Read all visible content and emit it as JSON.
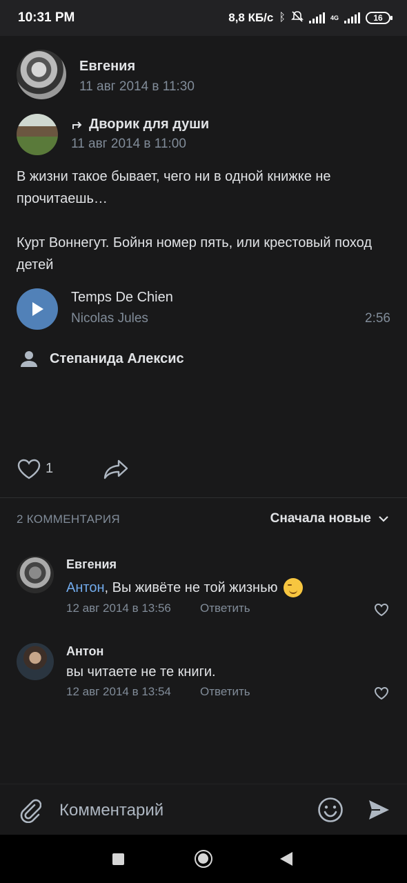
{
  "status_bar": {
    "time": "10:31 PM",
    "net_speed": "8,8 КБ/с",
    "network_type": "4G",
    "battery": "16"
  },
  "post": {
    "author_name": "Евгения",
    "author_date": "11 авг 2014 в 11:30",
    "repost_group_name": "Дворик для души",
    "repost_date": "11 авг 2014 в 11:00",
    "text_paragraphs": [
      "В жизни такое бывает, чего ни в одной книжке не прочитаешь…",
      "Курт Воннегут. Бойня номер пять, или крестовый поход детей"
    ],
    "audio": {
      "title": "Temps De Chien",
      "artist": "Nicolas Jules",
      "duration": "2:56"
    },
    "signer": "Степанида Алексис",
    "like_count": "1"
  },
  "comments_section": {
    "header": "2 КОММЕНТАРИЯ",
    "sort_label": "Сначала новые",
    "items": [
      {
        "author": "Евгения",
        "mention": "Антон",
        "text": ", Вы живёте не той жизнью",
        "date": "12 авг 2014 в 13:56",
        "reply_label": "Ответить"
      },
      {
        "author": "Антон",
        "mention": "",
        "text": "вы читаете не те книги.",
        "date": "12 авг 2014 в 13:54",
        "reply_label": "Ответить"
      }
    ]
  },
  "composer": {
    "placeholder": "Комментарий"
  },
  "colors": {
    "background": "#19191a",
    "accent": "#5181b8",
    "mention": "#71aaeb",
    "secondary_text": "#818c99"
  }
}
